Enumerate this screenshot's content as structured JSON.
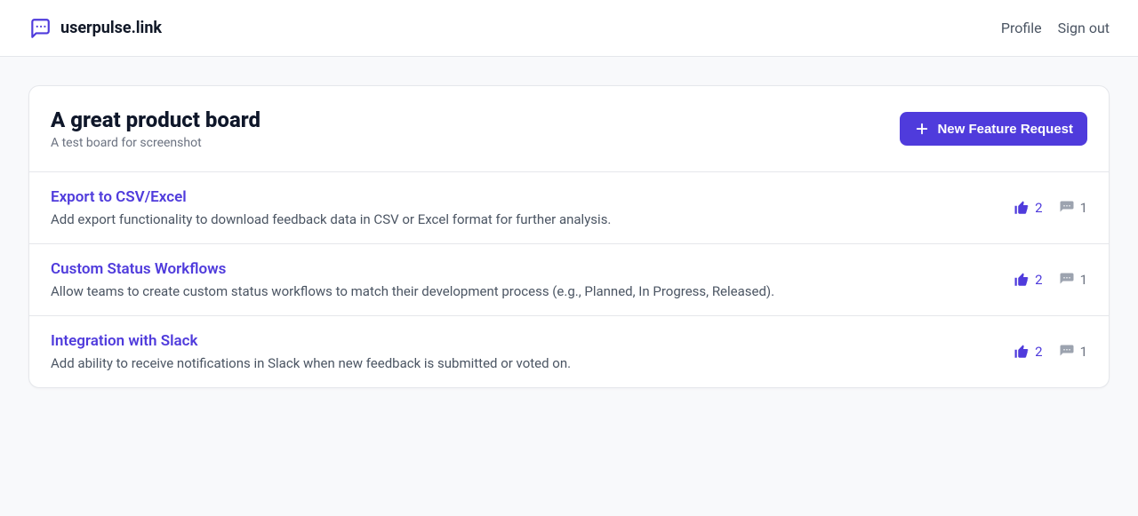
{
  "header": {
    "brand": "userpulse.link",
    "nav": {
      "profile": "Profile",
      "signout": "Sign out"
    }
  },
  "board": {
    "title": "A great product board",
    "description": "A test board for screenshot",
    "new_button_label": "New Feature Request"
  },
  "features": [
    {
      "title": "Export to CSV/Excel",
      "description": "Add export functionality to download feedback data in CSV or Excel format for further analysis.",
      "votes": "2",
      "comments": "1"
    },
    {
      "title": "Custom Status Workflows",
      "description": "Allow teams to create custom status workflows to match their development process (e.g., Planned, In Progress, Released).",
      "votes": "2",
      "comments": "1"
    },
    {
      "title": "Integration with Slack",
      "description": "Add ability to receive notifications in Slack when new feedback is submitted or voted on.",
      "votes": "2",
      "comments": "1"
    }
  ]
}
